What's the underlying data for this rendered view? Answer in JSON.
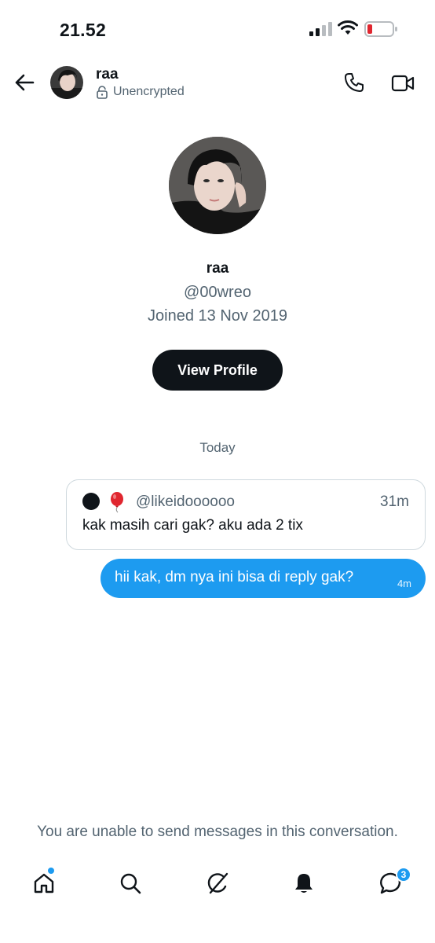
{
  "status_bar": {
    "time": "21.52",
    "icons": [
      "signal-icon",
      "wifi-icon",
      "battery-icon"
    ],
    "battery_color": "#e0262f"
  },
  "header": {
    "name": "raa",
    "encryption_status": "Unencrypted",
    "icons": [
      "back-arrow-icon",
      "lock-icon",
      "phone-icon",
      "video-camera-icon"
    ]
  },
  "profile": {
    "name": "raa",
    "handle": "@00wreo",
    "joined": "Joined 13 Nov 2019",
    "view_profile_label": "View Profile"
  },
  "conversation": {
    "date_divider": "Today",
    "quoted": {
      "handle": "@likeidoooooo",
      "time": "31m",
      "text": "kak masih cari gak? aku ada 2 tix"
    },
    "sent": {
      "text": "hii kak, dm nya ini bisa di reply gak?",
      "time": "4m"
    },
    "unable_notice": "You are unable to send messages in this conversation."
  },
  "bottom_nav": {
    "items": [
      "home-icon",
      "search-icon",
      "grok-icon",
      "bell-icon",
      "messages-icon"
    ],
    "messages_badge": "3"
  },
  "colors": {
    "accent": "#1d9bf0",
    "text_primary": "#0f1419",
    "text_secondary": "#536471",
    "border": "#cfd9de"
  }
}
